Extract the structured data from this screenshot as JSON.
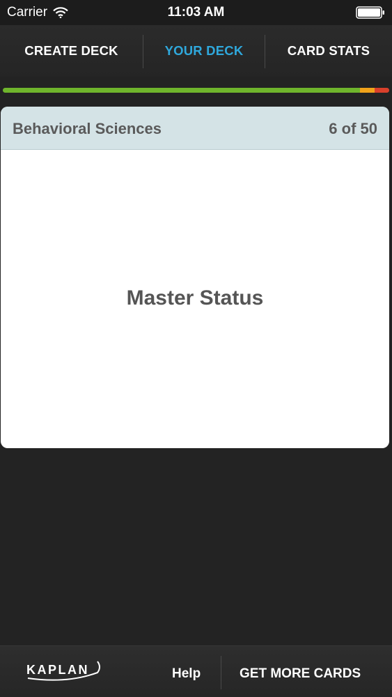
{
  "status_bar": {
    "carrier": "Carrier",
    "time": "11:03 AM",
    "wifi_icon": "wifi-icon",
    "battery_icon": "battery-icon"
  },
  "tabs": [
    {
      "label": "CREATE DECK",
      "active": false
    },
    {
      "label": "YOUR DECK",
      "active": true
    },
    {
      "label": "CARD STATS",
      "active": false
    }
  ],
  "colors": {
    "accent": "#2fa8dc",
    "progress_green": "#6fb52c",
    "progress_orange": "#f0a21a",
    "progress_red": "#d9402b",
    "card_header": "#d4e3e6"
  },
  "progress": {
    "segments": [
      {
        "name": "green",
        "fraction": 0.925
      },
      {
        "name": "orange",
        "fraction": 0.038
      },
      {
        "name": "red",
        "fraction": 0.037
      }
    ]
  },
  "card": {
    "deck_name": "Behavioral Sciences",
    "position": "6 of 50",
    "term": "Master Status"
  },
  "bottom": {
    "logo_text": "KAPLAN",
    "help_label": "Help",
    "more_label": "GET MORE CARDS"
  }
}
